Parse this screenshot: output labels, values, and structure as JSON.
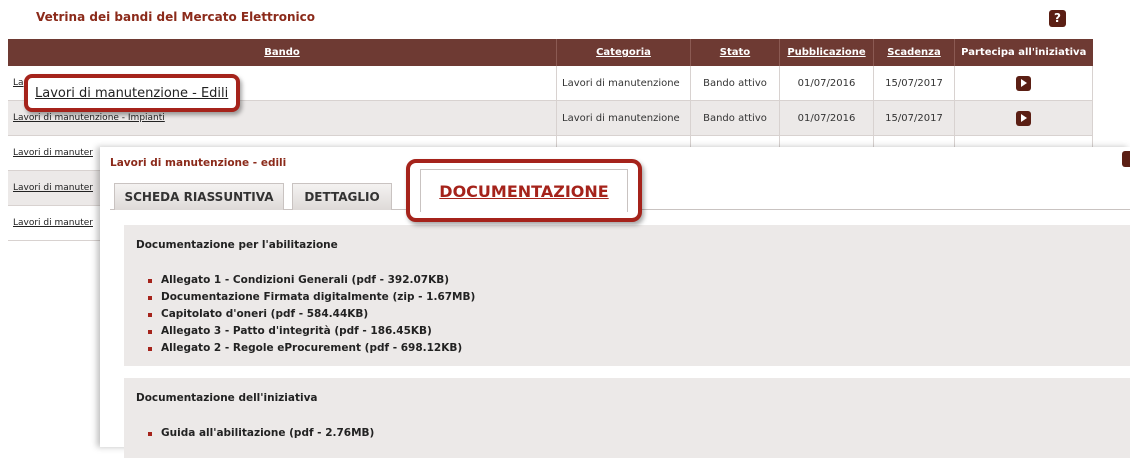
{
  "page_title": "Vetrina dei bandi del Mercato Elettronico",
  "help_icon": "question-icon",
  "table": {
    "headers": [
      "Bando",
      "Categoria",
      "Stato",
      "Pubblicazione",
      "Scadenza",
      "Partecipa all'iniziativa"
    ],
    "rows": [
      {
        "bando": "La",
        "categoria": "Lavori di manutenzione",
        "stato": "Bando attivo",
        "pubblicazione": "01/07/2016",
        "scadenza": "15/07/2017"
      },
      {
        "bando": "Lavori di manutenzione - Impianti",
        "categoria": "Lavori di manutenzione",
        "stato": "Bando attivo",
        "pubblicazione": "01/07/2016",
        "scadenza": "15/07/2017"
      },
      {
        "bando": "Lavori di manuter"
      },
      {
        "bando": "Lavori di manuter"
      },
      {
        "bando": "Lavori di manuter"
      }
    ],
    "highlighted_link": "Lavori di manutenzione - Edili"
  },
  "panel": {
    "title": "Lavori di manutenzione - edili",
    "tabs": [
      "SCHEDA RIASSUNTIVA",
      "DETTAGLIO",
      "DOCUMENTAZIONE"
    ],
    "active_tab": "DOCUMENTAZIONE",
    "sections": [
      {
        "heading": "Documentazione per l'abilitazione",
        "items": [
          "Allegato 1 - Condizioni Generali (pdf - 392.07KB)",
          "Documentazione Firmata digitalmente (zip - 1.67MB)",
          "Capitolato d'oneri (pdf - 584.44KB)",
          "Allegato 3 - Patto d'integrità (pdf - 186.45KB)",
          "Allegato 2 - Regole eProcurement (pdf - 698.12KB)"
        ]
      },
      {
        "heading": "Documentazione dell'iniziativa",
        "items": [
          "Guida all'abilitazione (pdf - 2.76MB)"
        ]
      }
    ]
  },
  "colors": {
    "header_bg": "#6e3a33",
    "accent": "#a5231b",
    "title": "#8b2a1a"
  }
}
